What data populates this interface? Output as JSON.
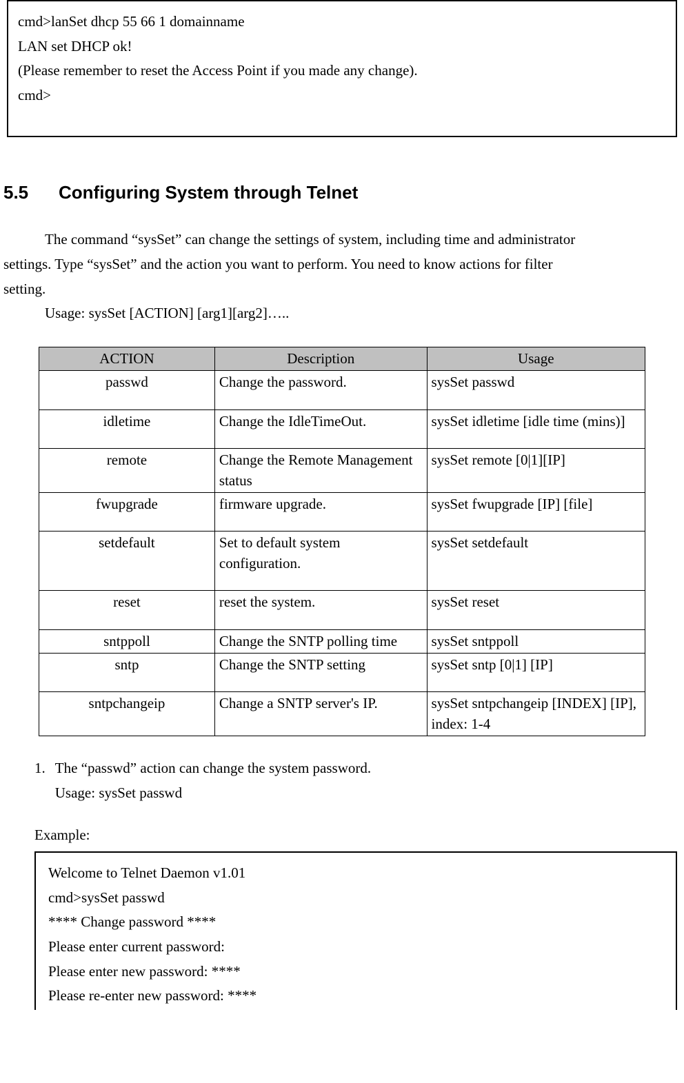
{
  "terminal1": {
    "l1": "cmd>lanSet dhcp 55 66 1 domainname",
    "l2": "LAN set DHCP ok!",
    "l3": "(Please remember to reset the Access Point if you made any change).",
    "l4": "cmd>"
  },
  "heading": {
    "num": "5.5",
    "title": "Configuring System through Telnet"
  },
  "intro": {
    "p1a": "The command “sysSet” can change the settings of system, including time and administrator",
    "p1b": "settings. Type “sysSet” and the action you want to perform. You need to know actions for filter",
    "p1c": "setting.",
    "usage": "Usage: sysSet [ACTION] [arg1][arg2]….."
  },
  "table": {
    "h1": "ACTION",
    "h2": "Description",
    "h3": "Usage",
    "rows": [
      {
        "a": "passwd",
        "d": "Change the password.",
        "u": "sysSet passwd"
      },
      {
        "a": "idletime",
        "d": "Change the IdleTimeOut.",
        "u": "sysSet idletime [idle time (mins)]"
      },
      {
        "a": "remote",
        "d": "Change the Remote Management status",
        "u": "sysSet remote [0|1][IP]"
      },
      {
        "a": "fwupgrade",
        "d": "firmware upgrade.",
        "u": "sysSet fwupgrade [IP] [file]"
      },
      {
        "a": "setdefault",
        "d": "Set to default system configuration.",
        "u": "sysSet setdefault"
      },
      {
        "a": "reset",
        "d": "reset the system.",
        "u": "sysSet reset"
      },
      {
        "a": "sntppoll",
        "d": "Change the SNTP polling time",
        "u": "sysSet sntppoll"
      },
      {
        "a": "sntp",
        "d": "Change the SNTP setting",
        "u": "sysSet sntp [0|1] [IP]"
      },
      {
        "a": "sntpchangeip",
        "d": "Change a SNTP server's IP.",
        "u": "sysSet sntpchangeip [INDEX] [IP], index: 1-4"
      }
    ]
  },
  "list": {
    "item1": {
      "num": "1.",
      "text": "The “passwd” action can change the system password.",
      "sub": "Usage: sysSet passwd"
    }
  },
  "example_label": "Example:",
  "terminal2": {
    "l1": "Welcome to Telnet Daemon v1.01",
    "l2": "cmd>sysSet passwd",
    "l3": "**** Change password ****",
    "l4": "Please enter current password:",
    "l5": "Please enter new password: ****",
    "l6": "Please re-enter new password: ****"
  }
}
